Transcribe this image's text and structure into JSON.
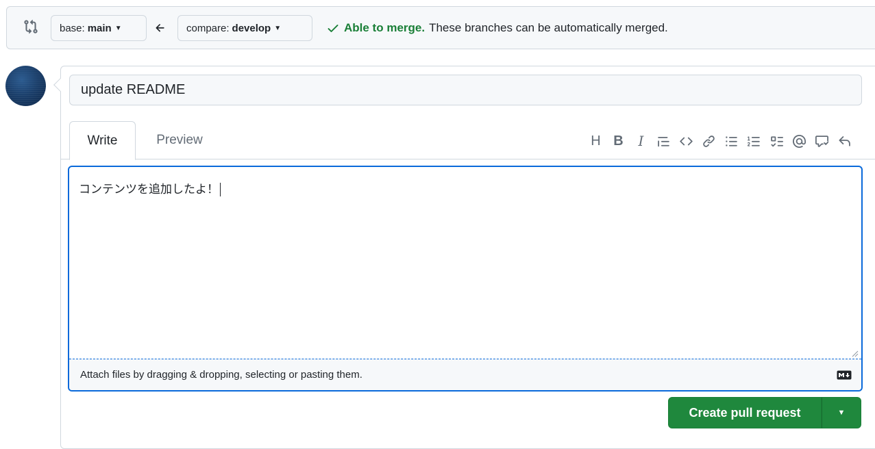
{
  "compare_bar": {
    "icon": "git-compare-icon",
    "base": {
      "prefix": "base:",
      "name": "main"
    },
    "compare": {
      "prefix": "compare:",
      "name": "develop"
    },
    "arrow_icon": "arrow-left-icon",
    "status_ok": "Able to merge.",
    "status_msg": "These branches can be automatically merged."
  },
  "form": {
    "title_value": "update README",
    "tabs": [
      {
        "label": "Write"
      },
      {
        "label": "Preview"
      }
    ],
    "toolbar": {
      "heading": "H",
      "bold": "B",
      "italic": "I",
      "icons": [
        "quote-icon",
        "code-icon",
        "link-icon",
        "unordered-list-icon",
        "ordered-list-icon",
        "task-list-icon",
        "mention-icon",
        "reference-icon",
        "undo-icon"
      ]
    },
    "body_value": "コンテンツを追加したよ！",
    "attach_text": "Attach files by dragging & dropping, selecting or pasting them.",
    "submit_label": "Create pull request"
  },
  "colors": {
    "accent": "#0969da",
    "success": "#1a7f37",
    "button": "#1f883d"
  }
}
